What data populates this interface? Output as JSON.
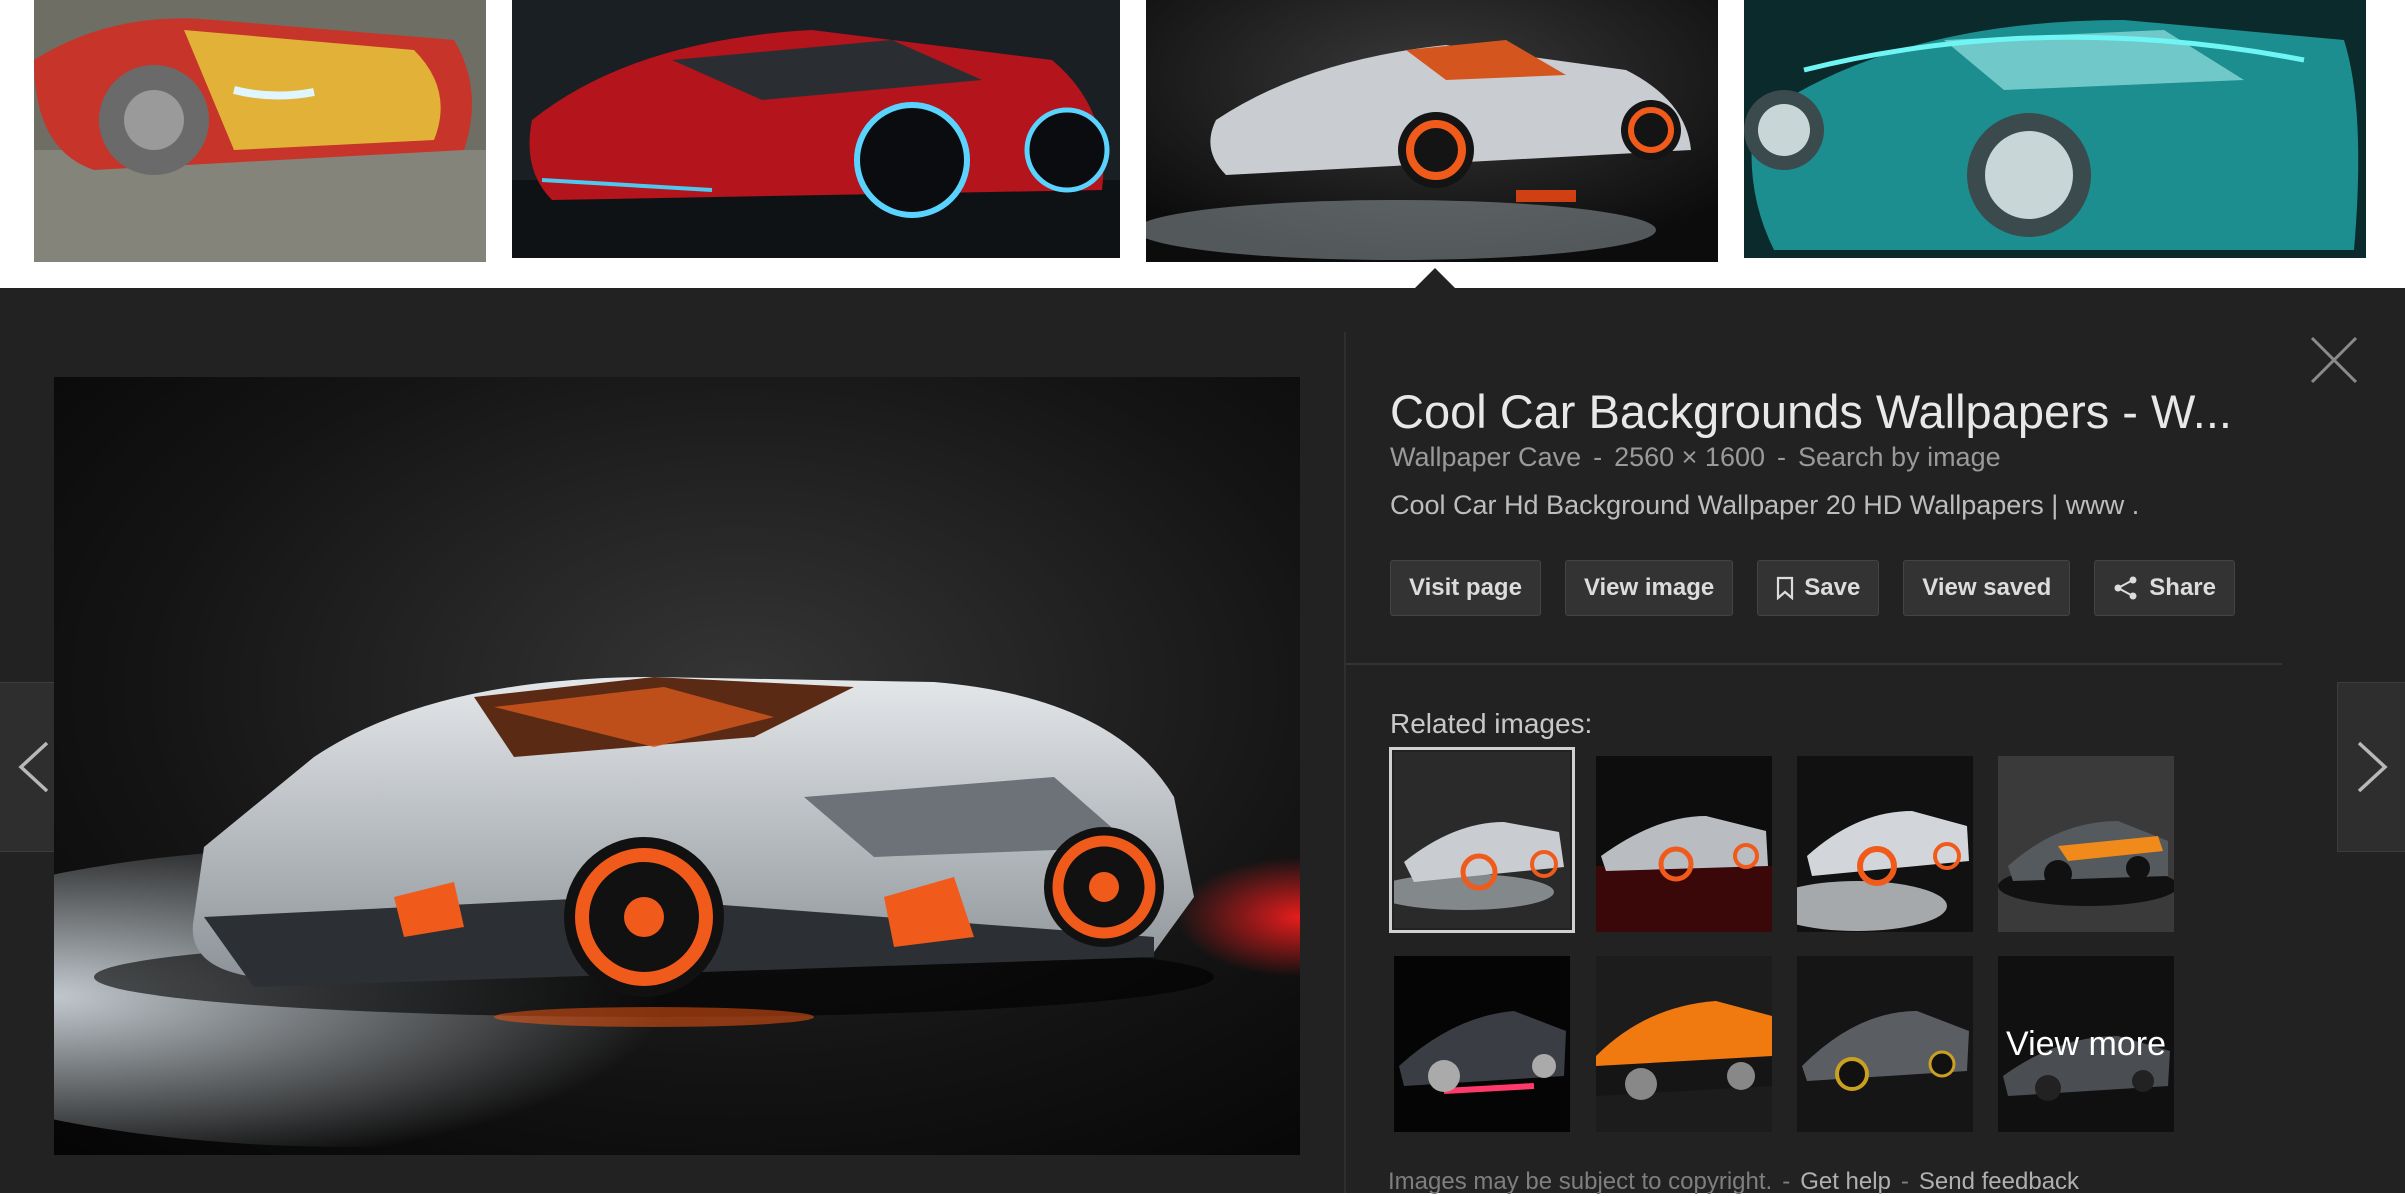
{
  "thumbnails": [
    {
      "name": "red-yellow sports car"
    },
    {
      "name": "red glowing supercar"
    },
    {
      "name": "silver concept car"
    },
    {
      "name": "teal neon roadster"
    }
  ],
  "preview": {
    "title": "Cool Car Backgrounds Wallpapers - W...",
    "source": "Wallpaper Cave",
    "dimensions": "2560 × 1600",
    "search_by_image": "Search by image",
    "description": "Cool Car Hd Background Wallpaper 20 HD Wallpapers | www .",
    "actions": {
      "visit_page": "Visit page",
      "view_image": "View image",
      "save": "Save",
      "view_saved": "View saved",
      "share": "Share"
    },
    "related_label": "Related images:",
    "view_more": "View more",
    "footer": {
      "copyright": "Images may be subject to copyright.",
      "get_help": "Get help",
      "send_feedback": "Send feedback"
    },
    "separator": "-"
  },
  "colors": {
    "panel_bg": "#222222",
    "accent_orange": "#f05a1a",
    "car_silver": "#c9cdd1"
  },
  "icons": [
    "close-icon",
    "chevron-left-icon",
    "chevron-right-icon",
    "bookmark-icon",
    "share-icon"
  ]
}
